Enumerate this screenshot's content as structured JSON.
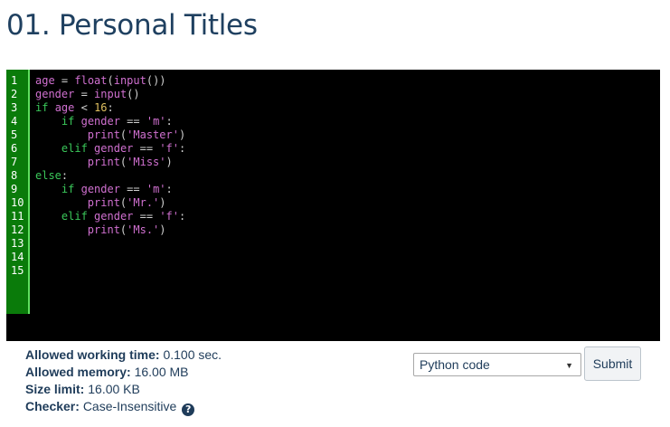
{
  "page": {
    "title": "01. Personal Titles"
  },
  "editor": {
    "line_numbers": [
      "1",
      "2",
      "3",
      "4",
      "5",
      "6",
      "7",
      "8",
      "9",
      "10",
      "11",
      "12",
      "13",
      "14",
      "15"
    ],
    "lines": [
      [
        {
          "t": "age",
          "c": "var"
        },
        {
          "t": " = ",
          "c": "op"
        },
        {
          "t": "float",
          "c": "fn"
        },
        {
          "t": "(",
          "c": "op"
        },
        {
          "t": "input",
          "c": "fn"
        },
        {
          "t": "())",
          "c": "op"
        }
      ],
      [
        {
          "t": "gender",
          "c": "var"
        },
        {
          "t": " = ",
          "c": "op"
        },
        {
          "t": "input",
          "c": "fn"
        },
        {
          "t": "()",
          "c": "op"
        }
      ],
      [
        {
          "t": "if",
          "c": "kw"
        },
        {
          "t": " ",
          "c": "op"
        },
        {
          "t": "age",
          "c": "var"
        },
        {
          "t": " < ",
          "c": "op"
        },
        {
          "t": "16",
          "c": "num"
        },
        {
          "t": ":",
          "c": "op"
        }
      ],
      [
        {
          "t": "    ",
          "c": "op"
        },
        {
          "t": "if",
          "c": "kw"
        },
        {
          "t": " ",
          "c": "op"
        },
        {
          "t": "gender",
          "c": "var"
        },
        {
          "t": " == ",
          "c": "op"
        },
        {
          "t": "'m'",
          "c": "str"
        },
        {
          "t": ":",
          "c": "op"
        }
      ],
      [
        {
          "t": "        ",
          "c": "op"
        },
        {
          "t": "print",
          "c": "fn"
        },
        {
          "t": "(",
          "c": "op"
        },
        {
          "t": "'Master'",
          "c": "str"
        },
        {
          "t": ")",
          "c": "op"
        }
      ],
      [
        {
          "t": "    ",
          "c": "op"
        },
        {
          "t": "elif",
          "c": "kw"
        },
        {
          "t": " ",
          "c": "op"
        },
        {
          "t": "gender",
          "c": "var"
        },
        {
          "t": " == ",
          "c": "op"
        },
        {
          "t": "'f'",
          "c": "str"
        },
        {
          "t": ":",
          "c": "op"
        }
      ],
      [
        {
          "t": "        ",
          "c": "op"
        },
        {
          "t": "print",
          "c": "fn"
        },
        {
          "t": "(",
          "c": "op"
        },
        {
          "t": "'Miss'",
          "c": "str"
        },
        {
          "t": ")",
          "c": "op"
        }
      ],
      [
        {
          "t": "else",
          "c": "kw"
        },
        {
          "t": ":",
          "c": "op"
        }
      ],
      [
        {
          "t": "    ",
          "c": "op"
        },
        {
          "t": "if",
          "c": "kw"
        },
        {
          "t": " ",
          "c": "op"
        },
        {
          "t": "gender",
          "c": "var"
        },
        {
          "t": " == ",
          "c": "op"
        },
        {
          "t": "'m'",
          "c": "str"
        },
        {
          "t": ":",
          "c": "op"
        }
      ],
      [
        {
          "t": "        ",
          "c": "op"
        },
        {
          "t": "print",
          "c": "fn"
        },
        {
          "t": "(",
          "c": "op"
        },
        {
          "t": "'Mr.'",
          "c": "str"
        },
        {
          "t": ")",
          "c": "op"
        }
      ],
      [
        {
          "t": "    ",
          "c": "op"
        },
        {
          "t": "elif",
          "c": "kw"
        },
        {
          "t": " ",
          "c": "op"
        },
        {
          "t": "gender",
          "c": "var"
        },
        {
          "t": " == ",
          "c": "op"
        },
        {
          "t": "'f'",
          "c": "str"
        },
        {
          "t": ":",
          "c": "op"
        }
      ],
      [
        {
          "t": "        ",
          "c": "op"
        },
        {
          "t": "print",
          "c": "fn"
        },
        {
          "t": "(",
          "c": "op"
        },
        {
          "t": "'Ms.'",
          "c": "str"
        },
        {
          "t": ")",
          "c": "op"
        }
      ],
      [],
      [],
      []
    ],
    "colors": {
      "background": "#000000",
      "gutter": "#0a7b0a",
      "keyword": "#3ac85a",
      "string": "#d070d0",
      "number": "#e0c060"
    }
  },
  "limits": {
    "time_label": "Allowed working time:",
    "time_value": "0.100 sec.",
    "memory_label": "Allowed memory:",
    "memory_value": "16.00 MB",
    "size_label": "Size limit:",
    "size_value": "16.00 KB",
    "checker_label": "Checker:",
    "checker_value": "Case-Insensitive",
    "help_icon": "question-circle-icon",
    "help_glyph": "?"
  },
  "submission": {
    "language_selected": "Python code",
    "dropdown_icon": "chevron-down-icon",
    "dropdown_glyph": "▼",
    "submit_label": "Submit"
  }
}
